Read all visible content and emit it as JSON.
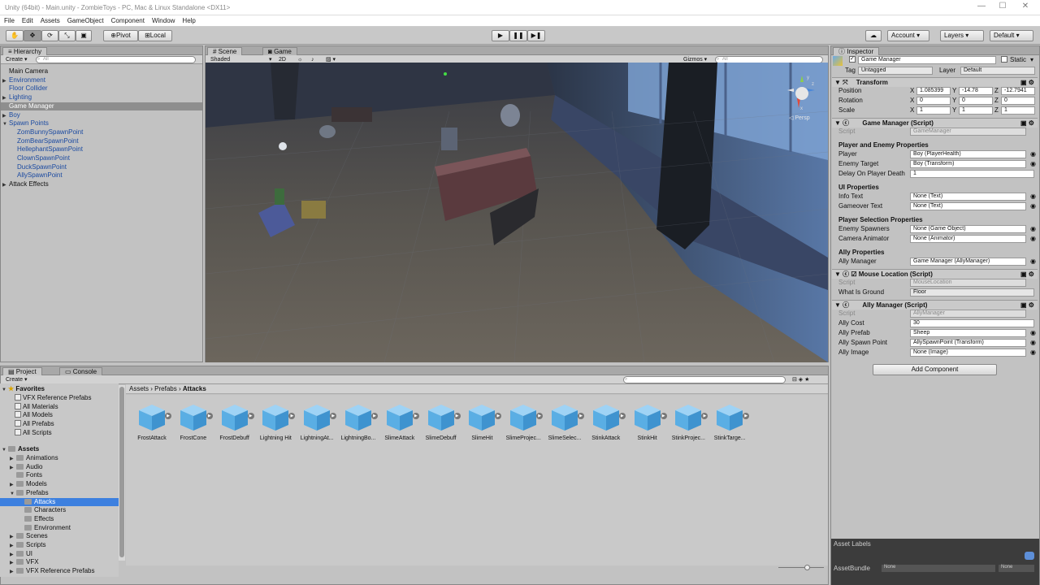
{
  "window": {
    "title": "Unity (64bit) - Main.unity - ZombieToys - PC, Mac & Linux Standalone <DX11>",
    "min": "—",
    "max": "☐",
    "close": "✕"
  },
  "menu": [
    "File",
    "Edit",
    "Assets",
    "GameObject",
    "Component",
    "Window",
    "Help"
  ],
  "toolbar": {
    "pivot": "Pivot",
    "local": "Local",
    "account": "Account",
    "layers": "Layers",
    "layout": "Default",
    "play": "▶",
    "pause": "❚❚",
    "step": "▶❚"
  },
  "hierarchy": {
    "tab": "Hierarchy",
    "create": "Create",
    "search_placeholder": "All",
    "items": [
      {
        "label": "Main Camera",
        "indent": 0,
        "expand": ""
      },
      {
        "label": "Environment",
        "indent": 0,
        "expand": "▶"
      },
      {
        "label": "Floor Collider",
        "indent": 0,
        "expand": ""
      },
      {
        "label": "Lighting",
        "indent": 0,
        "expand": "▶"
      },
      {
        "label": "Game Manager",
        "indent": 0,
        "expand": "",
        "selected": true
      },
      {
        "label": "Boy",
        "indent": 0,
        "expand": "▶"
      },
      {
        "label": "Spawn Points",
        "indent": 0,
        "expand": "▼"
      },
      {
        "label": "ZomBunnySpawnPoint",
        "indent": 1,
        "expand": ""
      },
      {
        "label": "ZomBearSpawnPoint",
        "indent": 1,
        "expand": ""
      },
      {
        "label": "HellephantSpawnPoint",
        "indent": 1,
        "expand": ""
      },
      {
        "label": "ClownSpawnPoint",
        "indent": 1,
        "expand": ""
      },
      {
        "label": "DuckSpawnPoint",
        "indent": 1,
        "expand": ""
      },
      {
        "label": "AllySpawnPoint",
        "indent": 1,
        "expand": ""
      },
      {
        "label": "Attack Effects",
        "indent": 0,
        "expand": "▶"
      }
    ]
  },
  "scene": {
    "tab_scene": "Scene",
    "tab_game": "Game",
    "shading": "Shaded",
    "mode2d": "2D",
    "gizmos": "Gizmos",
    "search_placeholder": "All",
    "persp": "Persp",
    "gizmo_y": "y",
    "gizmo_z": "z",
    "gizmo_x": "x"
  },
  "inspector": {
    "tab": "Inspector",
    "object_name": "Game Manager",
    "static": "Static",
    "tag_label": "Tag",
    "tag": "Untagged",
    "layer_label": "Layer",
    "layer": "Default",
    "transform": {
      "title": "Transform",
      "rows": [
        {
          "label": "Position",
          "x": "1.085399",
          "y": "-14.78",
          "z": "-12.7941"
        },
        {
          "label": "Rotation",
          "x": "0",
          "y": "0",
          "z": "0"
        },
        {
          "label": "Scale",
          "x": "1",
          "y": "1",
          "z": "1"
        }
      ],
      "X": "X",
      "Y": "Y",
      "Z": "Z"
    },
    "gm": {
      "title": "Game Manager (Script)",
      "script_label": "Script",
      "script": "GameManager",
      "sec1": "Player and Enemy Properties",
      "player_label": "Player",
      "player": "Boy (PlayerHealth)",
      "enemy_label": "Enemy Target",
      "enemy": "Boy (Transform)",
      "delay_label": "Delay On Player Death",
      "delay": "1",
      "sec2": "UI Properties",
      "info_label": "Info Text",
      "info": "None (Text)",
      "over_label": "Gameover Text",
      "over": "None (Text)",
      "sec3": "Player Selection Properties",
      "spawn_label": "Enemy Spawners",
      "spawn": "None (Game Object)",
      "cam_label": "Camera Animator",
      "cam": "None (Animator)",
      "sec4": "Ally Properties",
      "ally_label": "Ally Manager",
      "ally": "Game Manager (AllyManager)"
    },
    "ml": {
      "title": "Mouse Location (Script)",
      "script_label": "Script",
      "script": "MouseLocation",
      "ground_label": "What Is Ground",
      "ground": "Floor"
    },
    "am": {
      "title": "Ally Manager (Script)",
      "script_label": "Script",
      "script": "AllyManager",
      "cost_label": "Ally Cost",
      "cost": "30",
      "prefab_label": "Ally Prefab",
      "prefab": "Sheep",
      "spawnpt_label": "Ally Spawn Point",
      "spawnpt": "AllySpawnPoint (Transform)",
      "image_label": "Ally Image",
      "image": "None (Image)"
    },
    "add_component": "Add Component",
    "asset_labels": "Asset Labels",
    "asset_bundle": "AssetBundle",
    "bundle_val": "None",
    "bundle_val2": "None"
  },
  "project": {
    "tab": "Project",
    "tab_console": "Console",
    "create": "Create",
    "favorites": "Favorites",
    "fav_items": [
      "VFX Reference Prefabs",
      "All Materials",
      "All Models",
      "All Prefabs",
      "All Scripts"
    ],
    "assets": "Assets",
    "tree": [
      {
        "label": "Animations",
        "indent": 1,
        "expand": "▶"
      },
      {
        "label": "Audio",
        "indent": 1,
        "expand": "▶"
      },
      {
        "label": "Fonts",
        "indent": 1,
        "expand": ""
      },
      {
        "label": "Models",
        "indent": 1,
        "expand": "▶"
      },
      {
        "label": "Prefabs",
        "indent": 1,
        "expand": "▼"
      },
      {
        "label": "Attacks",
        "indent": 2,
        "expand": "",
        "selected": true
      },
      {
        "label": "Characters",
        "indent": 2,
        "expand": ""
      },
      {
        "label": "Effects",
        "indent": 2,
        "expand": ""
      },
      {
        "label": "Environment",
        "indent": 2,
        "expand": ""
      },
      {
        "label": "Scenes",
        "indent": 1,
        "expand": "▶"
      },
      {
        "label": "Scripts",
        "indent": 1,
        "expand": "▶"
      },
      {
        "label": "UI",
        "indent": 1,
        "expand": "▶"
      },
      {
        "label": "VFX",
        "indent": 1,
        "expand": "▶"
      },
      {
        "label": "VFX Reference Prefabs",
        "indent": 1,
        "expand": "▶"
      }
    ],
    "breadcrumb": [
      "Assets",
      "Prefabs",
      "Attacks"
    ],
    "assets_grid": [
      "FrostAttack",
      "FrostCone",
      "FrostDebuff",
      "Lightning Hit",
      "LightningAt...",
      "LightningBo...",
      "SlimeAttack",
      "SlimeDebuff",
      "SlimeHit",
      "SlimeProjec...",
      "SlimeSelec...",
      "StinkAttack",
      "StinkHit",
      "StinkProjec...",
      "StinkTarge..."
    ]
  },
  "colors": {
    "selection": "#3d80df",
    "cube": "#5aaee4"
  }
}
